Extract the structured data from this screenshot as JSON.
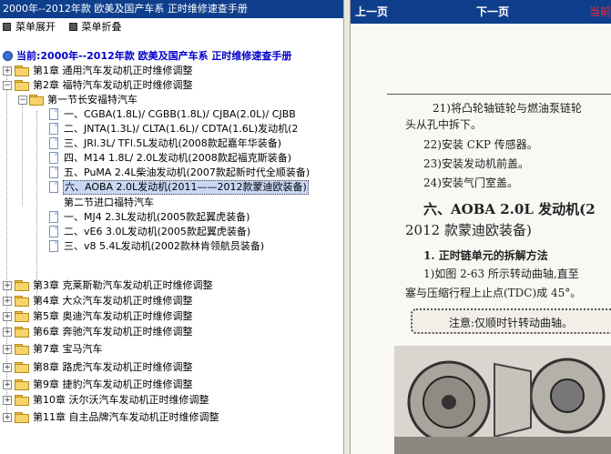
{
  "window": {
    "title": "2000年--2012年款 欧美及国产车系 正时维修速查手册"
  },
  "menu": {
    "expand_label": "菜单展开",
    "collapse_label": "菜单折叠"
  },
  "current": {
    "label": "当前:2000年--2012年款 欧美及国产车系 正时维修速查手册"
  },
  "tree": {
    "ch1": "第1章 通用汽车发动机正时维修调整",
    "ch2": "第2章 福特汽车发动机正时维修调整",
    "sec1": "第一节长安福特汽车",
    "s1_items": [
      "一、CGBA(1.8L)/ CGBB(1.8L)/ CJBA(2.0L)/ CJBB",
      "二、JNTA(1.3L)/ CLTA(1.6L)/ CDTA(1.6L)发动机(2",
      "三、JRl.3L/ TFl.5L发动机(2008款起嘉年华装备)",
      "四、M14 1.8L/ 2.0L发动机(2008款起福克斯装备)",
      "五、PuMA 2.4L柴油发动机(2007款起新时代全顺装备)",
      "六、AOBA 2.0L发动机(2011——2012款蒙迪欧装备)"
    ],
    "sec2": "第二节进口福特汽车",
    "s2_items": [
      "一、MJ4 2.3L发动机(2005款起翼虎装备)",
      "二、vE6 3.0L发动机(2005款起翼虎装备)",
      "三、v8 5.4L发动机(2002款林肯领航员装备)"
    ],
    "chapters_after": [
      "第3章 克莱斯勒汽车发动机正时维修调整",
      "第4章 大众汽车发动机正时维修调整",
      "第5章 奥迪汽车发动机正时维修调整",
      "第6章 奔驰汽车发动机正时维修调整",
      "第7章 宝马汽车",
      "第8章 路虎汽车发动机正时维修调整",
      "第9章 捷豹汽车发动机正时维修调整",
      "第10章 沃尔沃汽车发动机正时维修调整",
      "第11章 自主品牌汽车发动机正时维修调整"
    ]
  },
  "nav": {
    "prev": "上一页",
    "next": "下一页",
    "current": "当前"
  },
  "doc": {
    "line1": "21)将凸轮轴链轮与燃油泵链轮",
    "line2": "头从孔中拆下。",
    "line3": "22)安装 CKP 传感器。",
    "line4": "23)安装发动机前盖。",
    "line5": "24)安装气门室盖。",
    "heading1": "六、AOBA 2.0L 发动机(2",
    "heading2": "2012 款蒙迪欧装备)",
    "sub": "1. 正时链单元的拆解方法",
    "p1": "1)如图 2-63 所示转动曲轴,直至",
    "p2": "塞与压缩行程上止点(TDC)成 45°。",
    "note": "注意:仅顺时针转动曲轴。"
  }
}
